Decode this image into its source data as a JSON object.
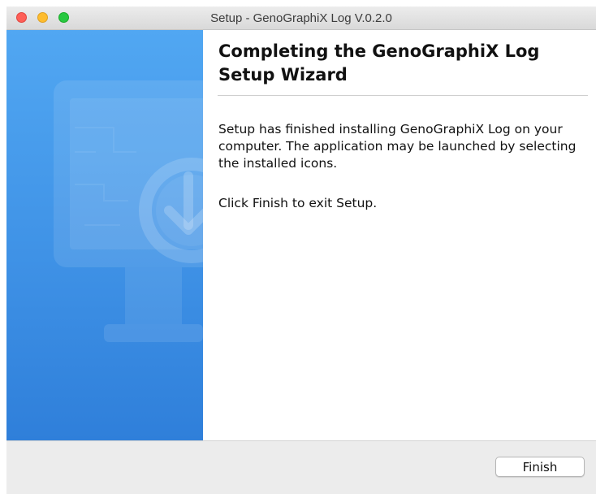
{
  "window": {
    "title": "Setup - GenoGraphiX Log V.0.2.0"
  },
  "titlebar_buttons": {
    "close_color": "#fe5f57",
    "minimize_color": "#febc2e",
    "zoom_color": "#28c840"
  },
  "side_panel": {
    "illustration_icon": "monitor-download-icon",
    "accent_color": "#3f92e6"
  },
  "content": {
    "heading": "Completing the GenoGraphiX Log Setup Wizard",
    "body_line1": "Setup has finished installing GenoGraphiX Log on your computer. The application may be launched by selecting the installed icons.",
    "body_line2": "Click Finish to exit Setup."
  },
  "footer": {
    "finish_label": "Finish"
  }
}
